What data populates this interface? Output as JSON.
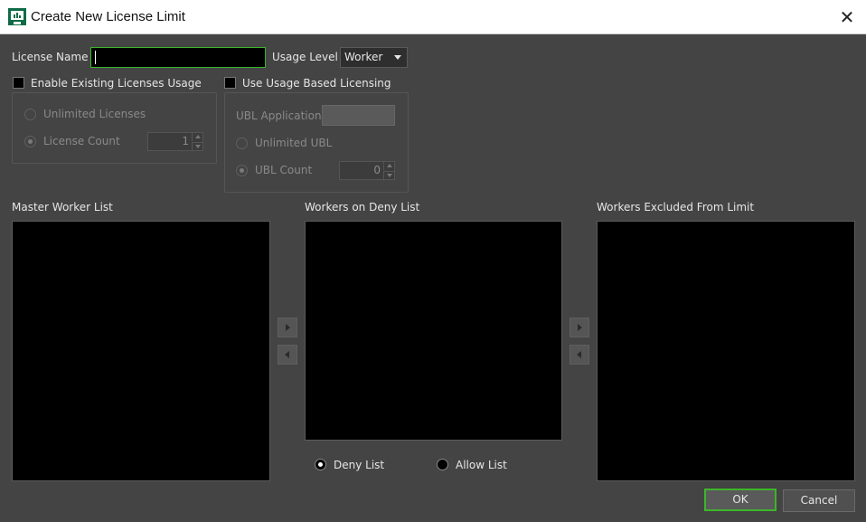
{
  "window": {
    "title": "Create New License Limit",
    "close_glyph": "✕"
  },
  "license_name": {
    "label": "License Name",
    "value": ""
  },
  "usage_level": {
    "label": "Usage Level",
    "selected": "Worker"
  },
  "existing_licenses": {
    "checkbox_label": "Enable Existing Licenses Usage",
    "checked": false,
    "unlimited_label": "Unlimited Licenses",
    "count_label": "License Count",
    "count_value": "1"
  },
  "ubl": {
    "checkbox_label": "Use Usage Based Licensing",
    "checked": false,
    "application_label": "UBL Application",
    "unlimited_label": "Unlimited UBL",
    "count_label": "UBL Count",
    "count_value": "0"
  },
  "lists": {
    "master_label": "Master Worker List",
    "deny_label": "Workers on Deny List",
    "excluded_label": "Workers Excluded From Limit"
  },
  "list_mode": {
    "deny_label": "Deny List",
    "allow_label": "Allow List",
    "selected": "Deny List"
  },
  "buttons": {
    "ok": "OK",
    "cancel": "Cancel"
  },
  "colors": {
    "accent": "#3db52a",
    "background": "#444444",
    "titlebar": "#ffffff"
  },
  "icons": {
    "app": "monitor-chart-icon",
    "close": "close-icon",
    "arrow_right": "arrow-right-icon",
    "arrow_left": "arrow-left-icon"
  }
}
